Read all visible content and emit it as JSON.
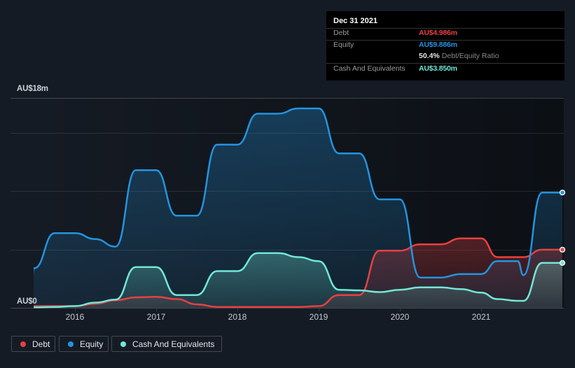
{
  "tooltip": {
    "date": "Dec 31 2021",
    "debt_label": "Debt",
    "debt_value": "AU$4.986m",
    "equity_label": "Equity",
    "equity_value": "AU$9.886m",
    "ratio_value": "50.4%",
    "ratio_label": "Debt/Equity Ratio",
    "cash_label": "Cash And Equivalents",
    "cash_value": "AU$3.850m"
  },
  "legend": {
    "items": [
      {
        "label": "Debt",
        "color": "#e64141"
      },
      {
        "label": "Equity",
        "color": "#2394df"
      },
      {
        "label": "Cash And Equivalents",
        "color": "#71e7d6"
      }
    ]
  },
  "chart_data": {
    "type": "area",
    "unit": "AU$ millions",
    "y_top_label": "AU$18m",
    "y_zero_label": "AU$0",
    "ylim": [
      0,
      18
    ],
    "x_ticks": [
      2016,
      2017,
      2018,
      2019,
      2020,
      2021
    ],
    "x_range": [
      2015.5,
      2022.0
    ],
    "x": [
      2015.44,
      2015.5,
      2015.75,
      2016.0,
      2016.25,
      2016.5,
      2016.75,
      2017.0,
      2017.25,
      2017.5,
      2017.75,
      2018.0,
      2018.25,
      2018.5,
      2018.75,
      2019.0,
      2019.25,
      2019.5,
      2019.75,
      2020.0,
      2020.25,
      2020.5,
      2020.75,
      2021.0,
      2021.2,
      2021.45,
      2021.52,
      2021.75,
      2022.0
    ],
    "series": [
      {
        "name": "Debt",
        "color": "#e64141",
        "values": [
          0.15,
          0.15,
          0.15,
          0.15,
          0.35,
          0.65,
          0.9,
          0.95,
          0.75,
          0.3,
          0.08,
          0.08,
          0.08,
          0.08,
          0.08,
          0.15,
          1.1,
          1.1,
          4.9,
          4.9,
          5.45,
          5.45,
          5.95,
          5.95,
          4.35,
          4.35,
          4.35,
          4.986,
          4.986
        ]
      },
      {
        "name": "Equity",
        "color": "#2394df",
        "values": [
          0.0,
          3.4,
          6.4,
          6.4,
          5.9,
          5.25,
          11.8,
          11.8,
          7.9,
          7.9,
          14.0,
          14.0,
          16.65,
          16.65,
          17.1,
          17.1,
          13.25,
          13.25,
          9.3,
          9.3,
          2.6,
          2.6,
          2.9,
          2.9,
          4.0,
          4.0,
          2.8,
          9.886,
          9.886
        ]
      },
      {
        "name": "Cash And Equivalents",
        "color": "#71e7d6",
        "values": [
          0.05,
          0.05,
          0.08,
          0.15,
          0.45,
          0.7,
          3.5,
          3.5,
          1.1,
          1.1,
          3.15,
          3.15,
          4.7,
          4.7,
          4.35,
          4.0,
          1.55,
          1.5,
          1.35,
          1.55,
          1.75,
          1.75,
          1.6,
          1.3,
          0.75,
          0.6,
          0.6,
          3.85,
          3.85
        ]
      }
    ],
    "grid_values": [
      5,
      10,
      15
    ]
  }
}
